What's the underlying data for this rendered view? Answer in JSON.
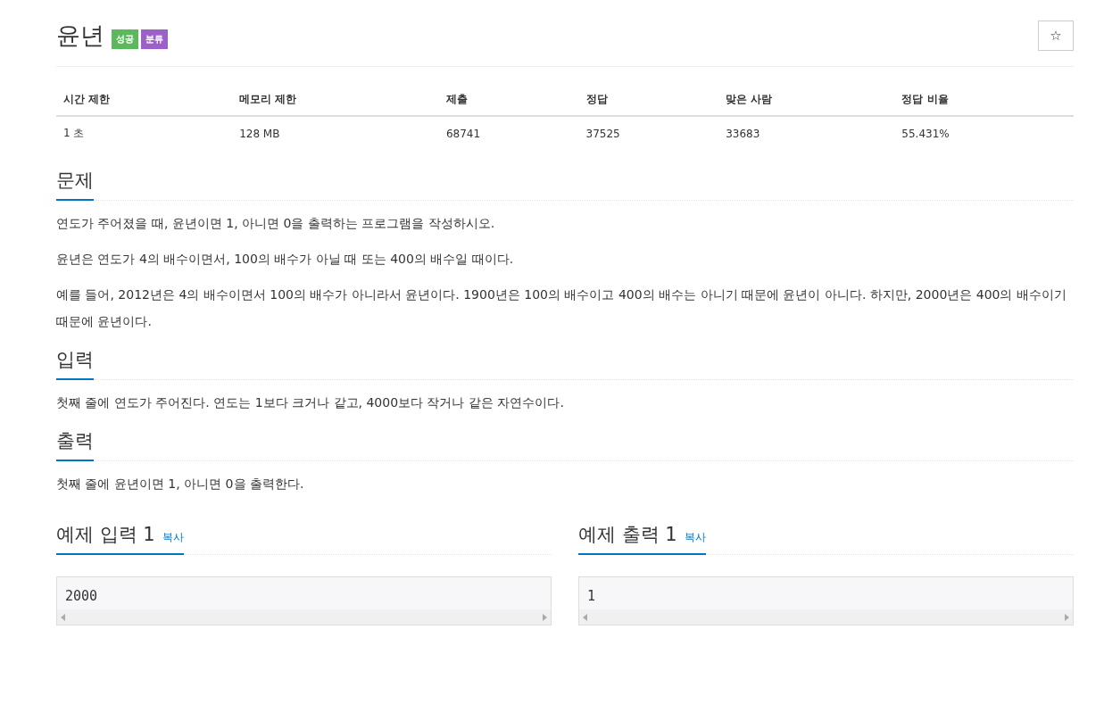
{
  "title": "윤년",
  "badges": [
    {
      "label": "성공",
      "color": "#5cb85c"
    },
    {
      "label": "분류",
      "color": "#9b61c9"
    }
  ],
  "star_button": {
    "label": "☆"
  },
  "info_table": {
    "columns": [
      "시간 제한",
      "메모리 제한",
      "제출",
      "정답",
      "맞은 사람",
      "정답 비율"
    ],
    "rows": [
      [
        "1 초",
        "128 MB",
        "68741",
        "37525",
        "33683",
        "55.431%"
      ]
    ]
  },
  "sections": [
    {
      "heading": "문제",
      "paragraphs": [
        "연도가 주어졌을 때, 윤년이면 1, 아니면 0을 출력하는 프로그램을 작성하시오.",
        "윤년은 연도가 4의 배수이면서, 100의 배수가 아닐 때 또는 400의 배수일 때이다.",
        "예를 들어, 2012년은 4의 배수이면서 100의 배수가 아니라서 윤년이다. 1900년은 100의 배수이고 400의 배수는 아니기 때문에 윤년이 아니다. 하지만, 2000년은 400의 배수이기 때문에 윤년이다."
      ]
    },
    {
      "heading": "입력",
      "paragraphs": [
        "첫째 줄에 연도가 주어진다. 연도는 1보다 크거나 같고, 4000보다 작거나 같은 자연수이다."
      ]
    },
    {
      "heading": "출력",
      "paragraphs": [
        "첫째 줄에 윤년이면 1, 아니면 0을 출력한다."
      ]
    }
  ],
  "samples": [
    {
      "heading": "예제 입력 1",
      "copy": "복사",
      "content": "2000"
    },
    {
      "heading": "예제 출력 1",
      "copy": "복사",
      "content": "1"
    }
  ]
}
